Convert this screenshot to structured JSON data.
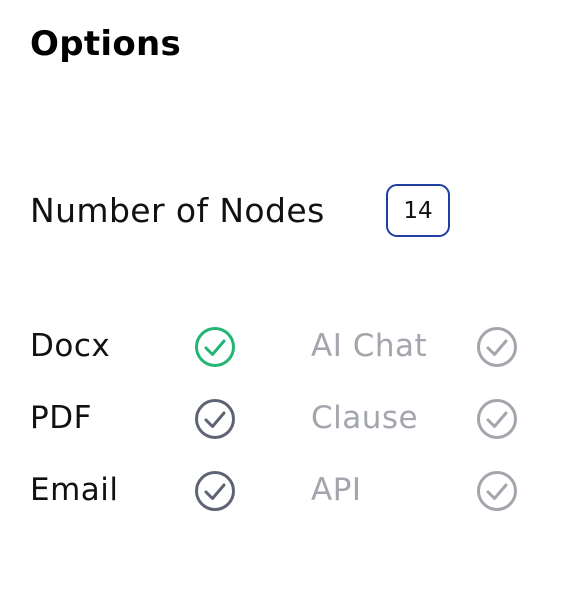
{
  "title": "Options",
  "nodes": {
    "label": "Number of Nodes",
    "value": "14"
  },
  "options": {
    "left": [
      {
        "label": "Docx",
        "state": "active",
        "color": "#22b573"
      },
      {
        "label": "PDF",
        "state": "checked",
        "color": "#5f6475"
      },
      {
        "label": "Email",
        "state": "checked",
        "color": "#5f6475"
      }
    ],
    "right": [
      {
        "label": "AI Chat",
        "state": "disabled",
        "color": "#a3a6ad"
      },
      {
        "label": "Clause",
        "state": "disabled",
        "color": "#a3a6ad"
      },
      {
        "label": "API",
        "state": "disabled",
        "color": "#a3a6ad"
      }
    ]
  },
  "colors": {
    "accent_border": "#1f3fa0",
    "active_check": "#22b573",
    "checked": "#5f6475",
    "disabled": "#a3a6ad"
  }
}
